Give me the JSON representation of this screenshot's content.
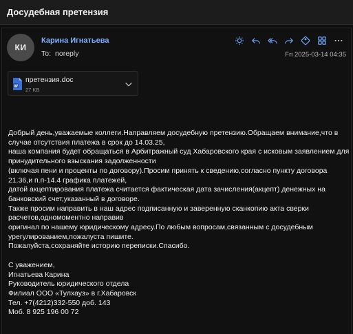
{
  "window": {
    "title": "Досудебная претензия"
  },
  "message": {
    "avatar_initials": "КИ",
    "sender_name": "Карина Игнатьева",
    "to_label": "To:",
    "to_value": "noreply",
    "date": "Fri 2025-03-14 04:35"
  },
  "toolbar": {
    "icons": [
      "sun-icon",
      "reply-icon",
      "reply-all-icon",
      "forward-icon",
      "tag-icon",
      "apps-icon",
      "more-icon"
    ]
  },
  "attachment": {
    "name": "претензия.doc",
    "size": "27 KB"
  },
  "body": {
    "lines": [
      "Добрый день,уважаемые коллеги.Направляем досудебную претензию.Обращаем внимание,что в случае отсутствия платежа в срок до 14.03.25,",
      "наша компания будет обращаться в Арбитражный суд Хабаровского края с исковым заявлением для принудительного взыскания задолженности",
      "(включая пени и проценты по договору).Просим принять к сведению,согласно пункту договора 21.36,и п.п-14.4 графика платежей,",
      "датой акцептирования платежа считается фактическая дата зачисления(акцепт) денежных на банковский счет,указанный в договоре.",
      "Также просим направить в наш адрес подписанную и заверенную сканкопию акта сверки расчетов,одномоментно направив",
      "оригинал по нашему юридическому адресу.По любым вопросам,связанным с досудебным урегулированием,пожалуста пишите.",
      "Пожалуйста,сохраняйте историю переписки.Спасибо."
    ],
    "signature": [
      "С уважением,",
      "Игнатьева Карина",
      "Руководитель юридического отдела",
      "Филиал ООО «Тулхауз» в г.Хабаровск",
      "Тел. +7(4212)332-550 доб. 143",
      "Моб. 8 925 196 00 72"
    ]
  },
  "colors": {
    "accent": "#7fb0ff",
    "background": "#0f0f0f",
    "title_bar": "#1c1c1c",
    "icon": "#6fa8ff"
  }
}
